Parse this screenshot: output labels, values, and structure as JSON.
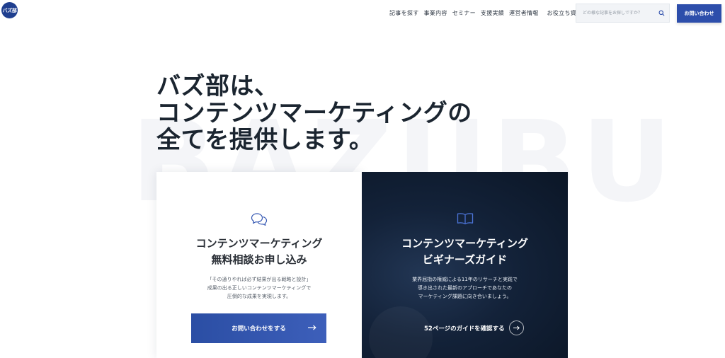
{
  "header": {
    "logo_text": "バズ部",
    "nav": [
      "記事を探す",
      "事業内容",
      "セミナー",
      "支援実績",
      "運営者情報",
      "お役立ち資料"
    ],
    "search_placeholder": "どの様な記事をお探しですか？",
    "contact_label": "お問い合わせ"
  },
  "hero": {
    "watermark": "BAZUBU",
    "title_lines": [
      "バズ部は、",
      "コンテンツマーケティングの",
      "全てを提供します。"
    ]
  },
  "cards": {
    "left": {
      "icon": "chat-bubbles-icon",
      "title_lines": [
        "コンテンツマーケティング",
        "無料相談お申し込み"
      ],
      "desc_lines": [
        "「その通りやれば必ず結果が出る戦略と設計」",
        "成果の出る正しいコンテンツマーケティングで",
        "圧倒的な成果を実現します。"
      ],
      "button_label": "お問い合わせをする"
    },
    "right": {
      "icon": "open-book-icon",
      "title_lines": [
        "コンテンツマーケティング",
        "ビギナーズガイド"
      ],
      "desc_lines": [
        "業界屈指の権威による11年のリサーチと実践で",
        "導き出された最新のアプローチであなたの",
        "マーケティング課題に向き合いましょう。"
      ],
      "link_label": "52ページのガイドを確認する"
    }
  },
  "colors": {
    "brand_blue": "#2d4eab",
    "dark_card": "#132239"
  }
}
